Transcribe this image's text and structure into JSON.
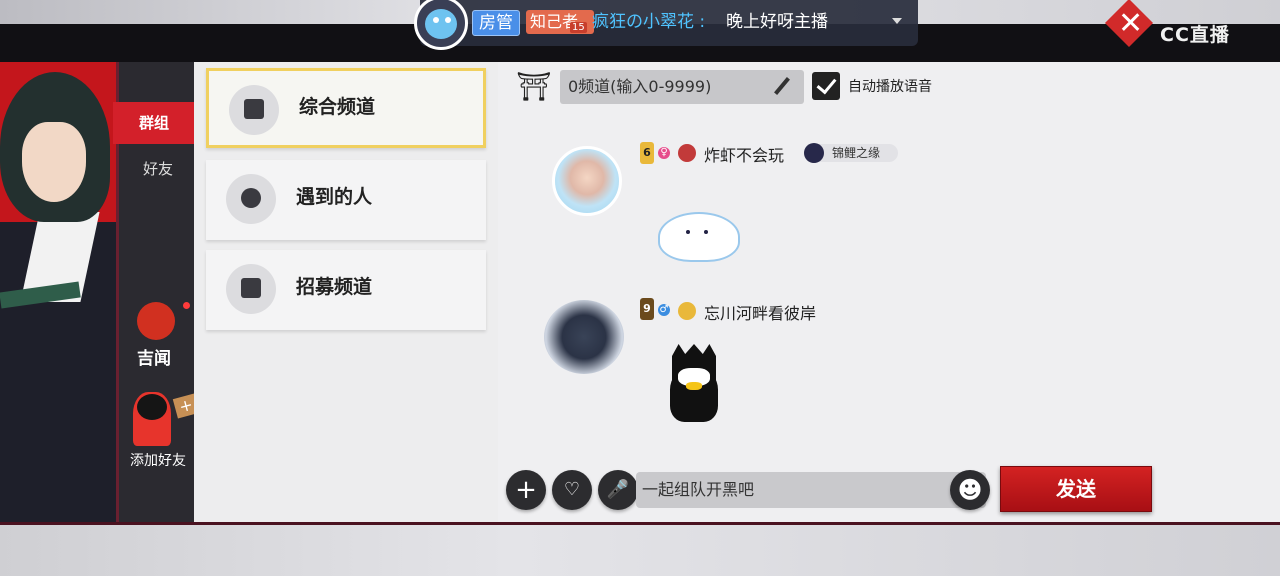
{
  "danmaku": {
    "badge_role": "房管",
    "badge_fan": "知己者",
    "badge_level": "15",
    "username": "疯狂の小翠花 :",
    "message": "晚上好呀主播"
  },
  "brand": {
    "logo_text": "CC直播",
    "close_glyph": "✕"
  },
  "side_tabs": {
    "group": "群组",
    "friends": "好友",
    "news": "吉闻",
    "add_friend": "添加好友"
  },
  "channels": [
    {
      "label": "综合频道",
      "active": true
    },
    {
      "label": "遇到的人",
      "active": false
    },
    {
      "label": "招募频道",
      "active": false
    }
  ],
  "chat_header": {
    "channel_input": "0频道(输入0-9999)",
    "autoplay_label": "自动播放语音",
    "autoplay_checked": true
  },
  "messages": [
    {
      "level": "6",
      "username": "炸虾不会玩",
      "title": "锦鲤之缘",
      "gender": "female",
      "content": "cinnamoroll-sticker"
    },
    {
      "level": "9",
      "username": "忘川河畔看彼岸",
      "gender": "male",
      "content": "badtz-maru-sticker"
    }
  ],
  "composer": {
    "placeholder": "一起组队开黑吧",
    "send_label": "发送",
    "plus_glyph": "+",
    "emoji_glyph": "☻",
    "mic_glyph": "🎤"
  },
  "colors": {
    "accent_red": "#d3202a",
    "active_border": "#f0d060"
  }
}
